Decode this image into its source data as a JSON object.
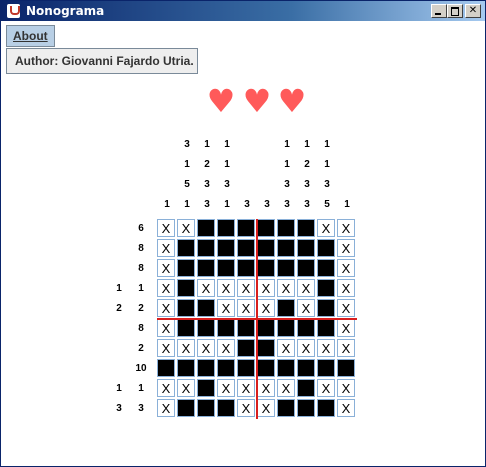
{
  "window": {
    "title": "Nonograma"
  },
  "menu": {
    "about_label": "About",
    "popup_item": "Author: Giovanni Fajardo Utria."
  },
  "lives": {
    "heart_glyph": "♥",
    "count": 3,
    "color": "#ff5a5a"
  },
  "puzzle": {
    "size": 10,
    "column_clues": [
      [
        1
      ],
      [
        3,
        1,
        5,
        1
      ],
      [
        1,
        2,
        3,
        3
      ],
      [
        1,
        1,
        3,
        1
      ],
      [
        3
      ],
      [
        3
      ],
      [
        1,
        1,
        3,
        3
      ],
      [
        1,
        2,
        3,
        3
      ],
      [
        1,
        1,
        3,
        5
      ],
      [
        1
      ]
    ],
    "row_clues": [
      [
        6
      ],
      [
        8
      ],
      [
        8
      ],
      [
        1,
        1
      ],
      [
        2,
        2
      ],
      [
        8
      ],
      [
        2
      ],
      [
        10
      ],
      [
        1,
        1
      ],
      [
        3,
        3
      ]
    ],
    "grid": [
      "xx######xx",
      "x########x",
      "x########x",
      "x#xxxxxx#x",
      "x##xxx#x#x",
      "x########x",
      "xxxx##xxxx",
      "##########",
      "xx#xxxx#xx",
      "x###xx###x"
    ],
    "cross_glyph": "X",
    "divider_color": "#d81e1e"
  }
}
